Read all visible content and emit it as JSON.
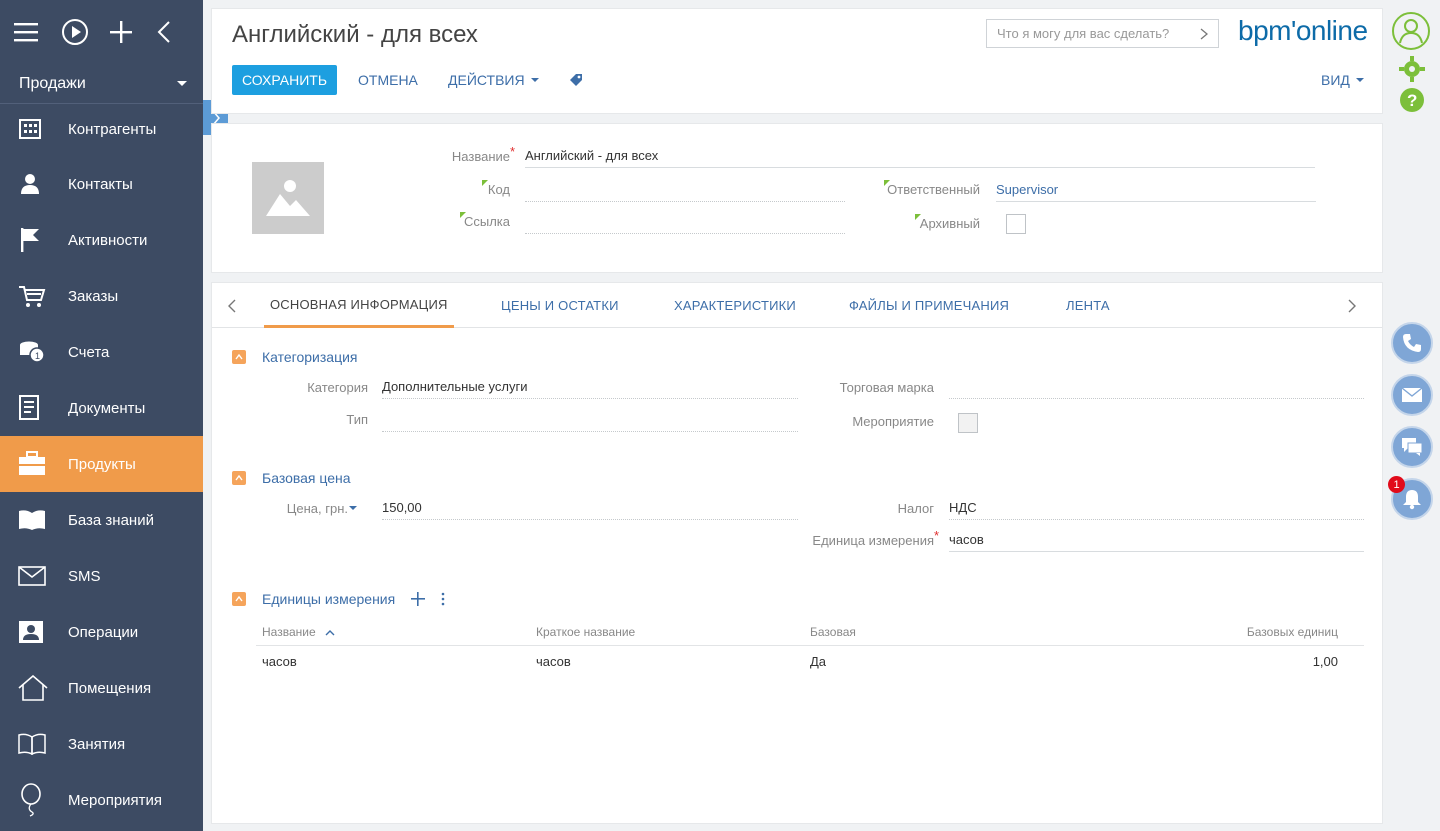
{
  "sidebar": {
    "workplace": "Продажи",
    "items": [
      {
        "label": "Контрагенты",
        "icon": "building-icon"
      },
      {
        "label": "Контакты",
        "icon": "person-icon"
      },
      {
        "label": "Активности",
        "icon": "flag-icon"
      },
      {
        "label": "Заказы",
        "icon": "cart-icon"
      },
      {
        "label": "Счета",
        "icon": "coins-icon"
      },
      {
        "label": "Документы",
        "icon": "document-icon"
      },
      {
        "label": "Продукты",
        "icon": "briefcase-icon",
        "active": true
      },
      {
        "label": "База знаний",
        "icon": "open-book-icon"
      },
      {
        "label": "SMS",
        "icon": "envelope-icon"
      },
      {
        "label": "Операции",
        "icon": "id-card-icon"
      },
      {
        "label": "Помещения",
        "icon": "house-icon"
      },
      {
        "label": "Занятия",
        "icon": "book-icon"
      },
      {
        "label": "Мероприятия",
        "icon": "balloon-icon"
      }
    ]
  },
  "header": {
    "title": "Английский - для всех",
    "search_placeholder": "Что я могу для вас сделать?",
    "logo": "bpm'online",
    "save": "СОХРАНИТЬ",
    "cancel": "ОТМЕНА",
    "actions": "ДЕЙСТВИЯ",
    "view": "ВИД"
  },
  "card": {
    "name_label": "Название",
    "name_value": "Английский - для всех",
    "code_label": "Код",
    "code_value": "",
    "link_label": "Ссылка",
    "link_value": "",
    "owner_label": "Ответственный",
    "owner_value": "Supervisor",
    "archived_label": "Архивный"
  },
  "tabs": [
    "ОСНОВНАЯ ИНФОРМАЦИЯ",
    "ЦЕНЫ И ОСТАТКИ",
    "ХАРАКТЕРИСТИКИ",
    "ФАЙЛЫ И ПРИМЕЧАНИЯ",
    "ЛЕНТА"
  ],
  "categorization": {
    "title": "Категоризация",
    "category_label": "Категория",
    "category_value": "Дополнительные услуги",
    "type_label": "Тип",
    "type_value": "",
    "brand_label": "Торговая марка",
    "brand_value": "",
    "event_label": "Мероприятие"
  },
  "base_price": {
    "title": "Базовая цена",
    "price_label": "Цена, грн.",
    "price_value": "150,00",
    "tax_label": "Налог",
    "tax_value": "НДС",
    "unit_label": "Единица измерения",
    "unit_value": "часов"
  },
  "units": {
    "title": "Единицы измерения",
    "columns": [
      "Название",
      "Краткое название",
      "Базовая",
      "Базовых единиц"
    ],
    "rows": [
      [
        "часов",
        "часов",
        "Да",
        "1,00"
      ]
    ]
  },
  "notifications_count": "1",
  "colors": {
    "sidebar": "#3d4b63",
    "accent": "#f09b4a",
    "primary": "#1d9fe0",
    "link": "#3d6ea8"
  }
}
